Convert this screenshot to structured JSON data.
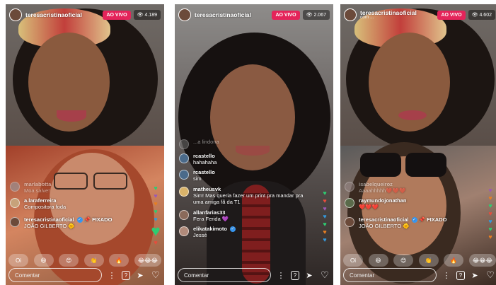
{
  "panels": [
    {
      "host": "teresacristinaoficial",
      "live_label": "AO VIVO",
      "viewers": "👁 4.189",
      "comments": [
        {
          "user": "marlabotta",
          "text": "Moa salve!",
          "faded": true,
          "avatar_color": "#8aa0b0"
        },
        {
          "user": "a.laraferreira",
          "text": "Compositora foda",
          "faded": false,
          "avatar_color": "#c7a27a"
        },
        {
          "user": "teresacristinaoficial",
          "pin": "📌 FIXADO",
          "text": "JOÃO GILBERTO 🌞",
          "faded": false,
          "avatar_color": "#6b4a3a"
        }
      ],
      "quick": [
        "Oi",
        "😄",
        "😍",
        "👏",
        "🔥",
        "😂😂😂"
      ],
      "comment_placeholder": "Comentar"
    },
    {
      "host": "teresacristinaoficial",
      "live_label": "AO VIVO",
      "viewers": "👁 2.067",
      "comments": [
        {
          "user": "",
          "text": "...a lindona",
          "faded": true,
          "avatar_color": "#777777"
        },
        {
          "user": "rcastello",
          "text": "hahahaha",
          "faded": false,
          "avatar_color": "#4a6a8a"
        },
        {
          "user": "rcastello",
          "text": "sim",
          "faded": false,
          "avatar_color": "#4a6a8a"
        },
        {
          "user": "matheusvk",
          "text": "Sim! Mas queria fazer um print pra mandar pra uma amiga fã da T1",
          "faded": false,
          "avatar_color": "#d9b36a"
        },
        {
          "user": "allanfarias33",
          "text": "Fera Ferida 💜",
          "faded": false,
          "avatar_color": "#8a6a5a"
        },
        {
          "user": "elikatakimoto",
          "verified": "✓",
          "text": "Jessé",
          "faded": false,
          "avatar_color": "#b08a7a"
        }
      ],
      "comment_placeholder": "Comentar"
    },
    {
      "host": "teresacristinaoficial",
      "subtitle": "com ...",
      "live_label": "AO VIVO",
      "viewers": "👁 4.602",
      "comments": [
        {
          "user": "isabelqueiroz",
          "text": "Aaaahhhhh❤️❤️❤️",
          "faded": true,
          "avatar_color": "#9a8a8a"
        },
        {
          "user": "raymundojonathan",
          "text": "❤️❤️❤️",
          "faded": false,
          "avatar_color": "#5a6a4a"
        },
        {
          "user": "teresacristinaoficial",
          "pin": "📌 FIXADO",
          "text": "JOÃO GILBERTO 🌞",
          "faded": false,
          "avatar_color": "#6b4a3a"
        }
      ],
      "quick": [
        "Oi",
        "😄",
        "😍",
        "👏",
        "🔥",
        "😂😂😂"
      ],
      "comment_placeholder": "Comentar"
    }
  ],
  "verified_mark": "✓",
  "icons": {
    "more": "⋮",
    "question": "?",
    "send": "➤",
    "heart": "♡"
  },
  "colors": {
    "live": "#e4245a",
    "verified": "#3897f0"
  }
}
